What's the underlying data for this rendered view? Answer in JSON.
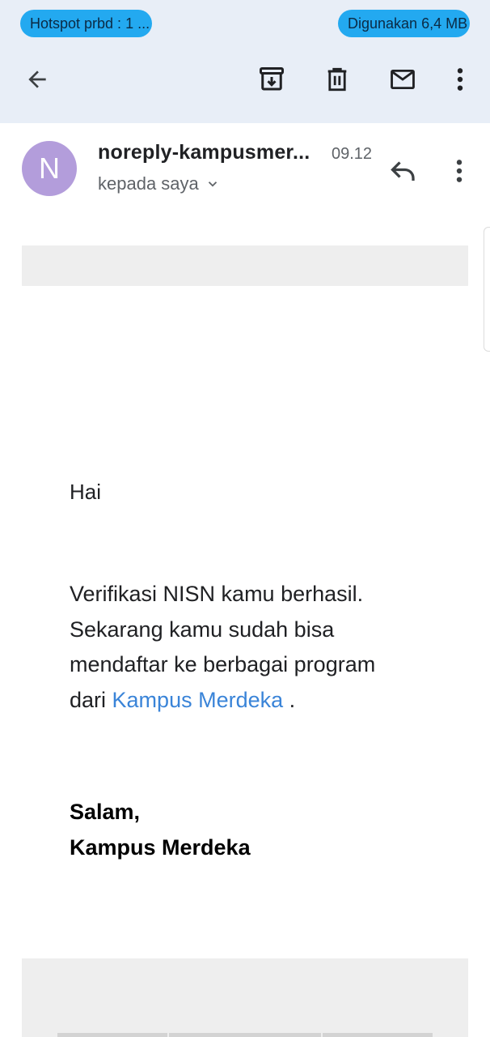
{
  "status": {
    "hotspot_label": "Hotspot prbd : 1 ...",
    "data_usage_label": "Digunakan 6,4 MB"
  },
  "toolbar": {
    "back_icon": "arrow-back-icon",
    "archive_icon": "archive-icon",
    "delete_icon": "trash-icon",
    "mark_unread_icon": "mail-icon",
    "more_icon": "more-vert-icon"
  },
  "email": {
    "avatar_letter": "N",
    "avatar_color": "#b39ddb",
    "sender": "noreply-kampusmer...",
    "time": "09.12",
    "recipient": "kepada saya",
    "greeting": "Hai",
    "body_lines": [
      "Verifikasi NISN kamu berhasil.",
      "Sekarang kamu sudah bisa",
      "mendaftar ke berbagai program"
    ],
    "body_prefix": "dari ",
    "link_text": "Kampus Merdeka",
    "body_suffix": " .",
    "sign_off": "Salam,",
    "signature": "Kampus Merdeka",
    "link_color": "#3a84d8"
  }
}
